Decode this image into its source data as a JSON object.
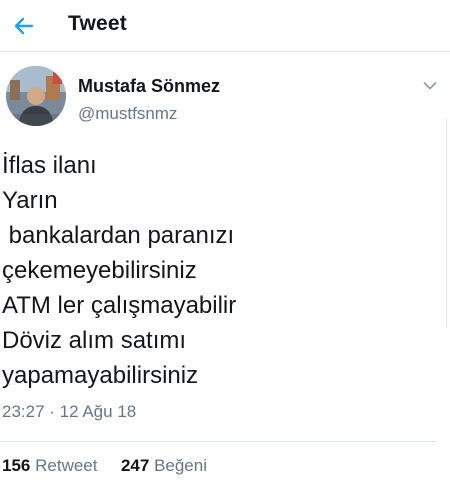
{
  "header": {
    "title": "Tweet",
    "back_icon": "arrow-left-icon",
    "accent_color": "#1da1f2"
  },
  "author": {
    "name": "Mustafa Sönmez",
    "handle": "@mustfsnmz"
  },
  "tweet": {
    "lines": [
      "İflas ilanı",
      "Yarın",
      " bankalardan paranızı",
      "çekemeyebilirsiniz",
      "ATM ler çalışmayabilir",
      "Döviz alım satımı",
      "yapamayabilirsiniz"
    ],
    "timestamp": "23:27 · 12 Ağu 18"
  },
  "stats": {
    "retweet_count": "156",
    "retweet_label": "Retweet",
    "like_count": "247",
    "like_label": "Beğeni"
  },
  "colors": {
    "text": "#14171a",
    "secondary": "#657786",
    "divider": "#e1e8ed"
  }
}
